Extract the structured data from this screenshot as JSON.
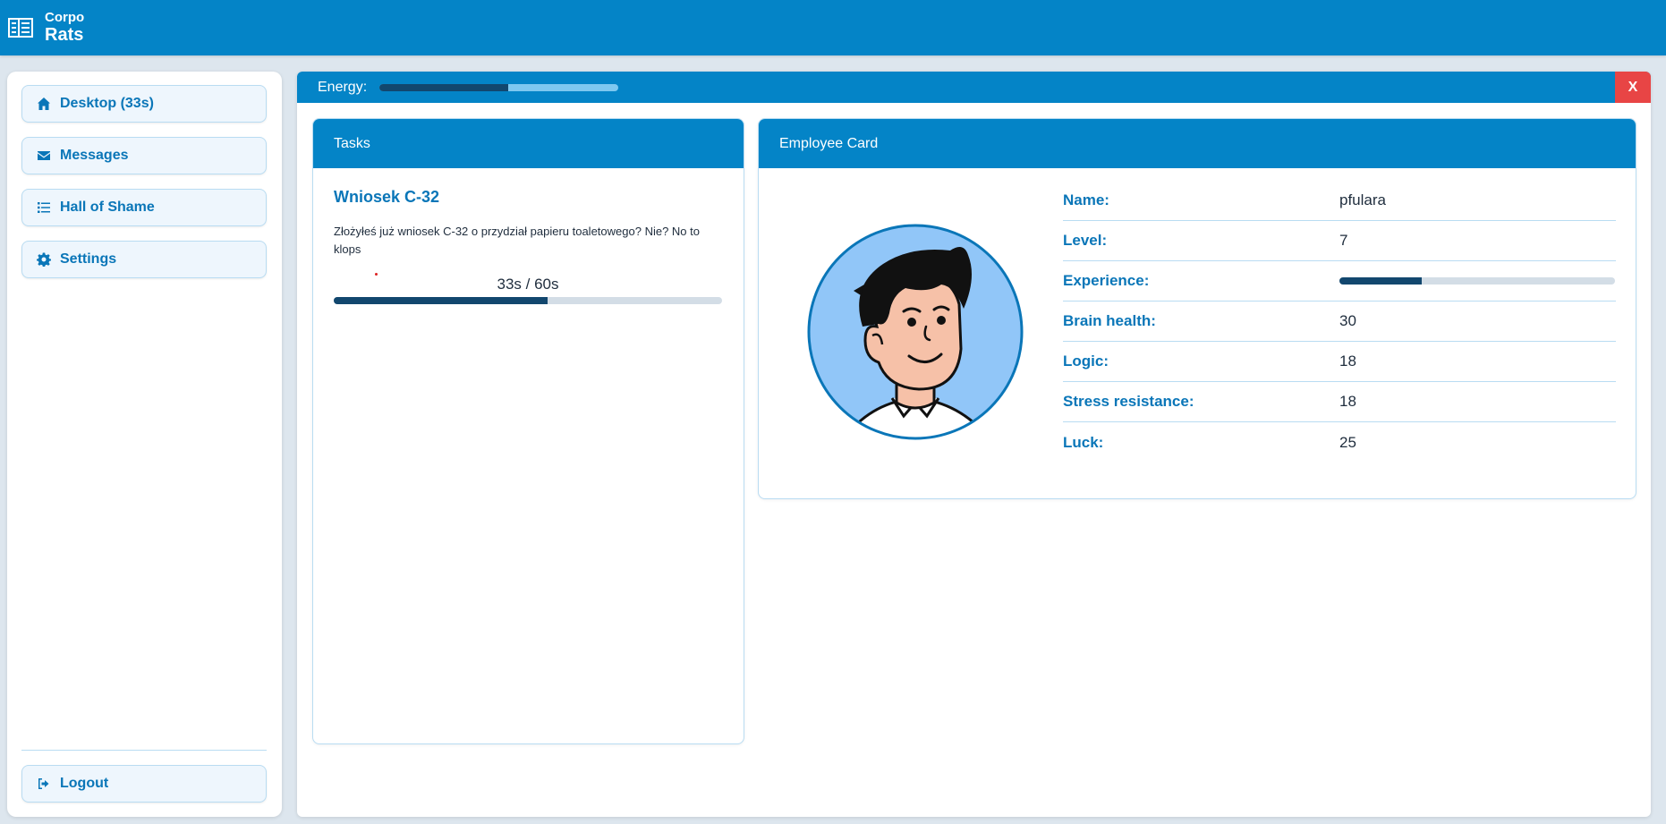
{
  "brand": {
    "line1": "Corpo",
    "line2": "Rats",
    "icon": "building-icon"
  },
  "sidebar": {
    "items": [
      {
        "label": "Desktop (33s)",
        "icon": "home-icon"
      },
      {
        "label": "Messages",
        "icon": "envelope-icon"
      },
      {
        "label": "Hall of Shame",
        "icon": "list-icon"
      },
      {
        "label": "Settings",
        "icon": "gear-icon"
      }
    ],
    "logout": {
      "label": "Logout",
      "icon": "sign-out-icon"
    }
  },
  "energy": {
    "label": "Energy:",
    "level": 0.54
  },
  "close_label": "X",
  "tasks": {
    "header": "Tasks",
    "task": {
      "title": "Wniosek C-32",
      "description": "Złożyłeś już wniosek C-32 o przydział papieru toaletowego? Nie? No to klops",
      "timer": "33s / 60s",
      "progress": 0.55
    }
  },
  "employee": {
    "header": "Employee Card",
    "avatar_icon": "avatar-icon",
    "stats": [
      {
        "label": "Name:",
        "value": "pfulara"
      },
      {
        "label": "Level:",
        "value": "7"
      },
      {
        "label": "Experience:",
        "value": "",
        "progress": 0.3
      },
      {
        "label": "Brain health:",
        "value": "30"
      },
      {
        "label": "Logic:",
        "value": "18"
      },
      {
        "label": "Stress resistance:",
        "value": "18"
      },
      {
        "label": "Luck:",
        "value": "25"
      }
    ]
  },
  "colors": {
    "primary": "#0484c7",
    "accent_text": "#0a76b8",
    "dark_fill": "#12476e",
    "close": "#e84545"
  }
}
